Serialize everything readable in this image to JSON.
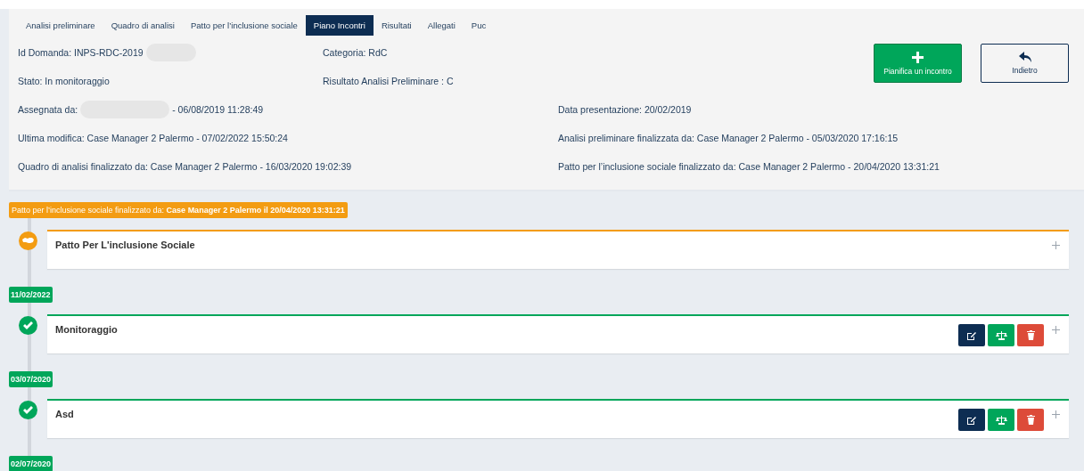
{
  "tabs": [
    {
      "label": "Analisi preliminare",
      "selected": false
    },
    {
      "label": "Quadro di analisi",
      "selected": false
    },
    {
      "label": "Patto per l’inclusione sociale",
      "selected": false
    },
    {
      "label": "Piano Incontri",
      "selected": true
    },
    {
      "label": "Risultati",
      "selected": false
    },
    {
      "label": "Allegati",
      "selected": false
    },
    {
      "label": "Puc",
      "selected": false
    }
  ],
  "info_top": [
    [
      {
        "text": "Id Domanda: INPS-RDC-2019",
        "redacted": true
      },
      {
        "text": "Categoria: RdC"
      }
    ],
    [
      {
        "text": "Stato: In monitoraggio"
      },
      {
        "text": "Risultato Analisi Preliminare : C"
      }
    ]
  ],
  "info_rows": [
    [
      {
        "text": "Assegnata da:",
        "redacted": true,
        "suffix": "- 06/08/2019 11:28:49"
      },
      {
        "text": "Data presentazione: 20/02/2019"
      }
    ],
    [
      {
        "text": "Ultima modifica: Case Manager 2 Palermo - 07/02/2022 15:50:24"
      },
      {
        "text": "Analisi preliminare finalizzata da: Case Manager 2 Palermo - 05/03/2020 17:16:15"
      }
    ],
    [
      {
        "text": "Quadro di analisi finalizzato da: Case Manager 2 Palermo - 16/03/2020 19:02:39"
      },
      {
        "text": "Patto per l’inclusione sociale finalizzato da: Case Manager 2 Palermo - 20/04/2020 13:31:21"
      }
    ]
  ],
  "buttons": [
    {
      "kind": "add",
      "label": "Pianifica un incontro"
    },
    {
      "kind": "back",
      "label": "Indietro"
    }
  ],
  "timeline": [
    {
      "kind": "banner",
      "text": "Patto per l’inclusione sociale finalizzato da: **Case Manager 2 Palermo il 20/04/2020 13:31:21**"
    },
    {
      "kind": "pact",
      "title": "Patto Per L'inclusione Sociale",
      "actions": false
    },
    {
      "kind": "date",
      "text": "11/02/2022"
    },
    {
      "kind": "meeting",
      "title": "Monitoraggio",
      "actions": true
    },
    {
      "kind": "date",
      "text": "03/07/2020"
    },
    {
      "kind": "meeting",
      "title": "Asd",
      "actions": true
    },
    {
      "kind": "date",
      "text": "02/07/2020"
    }
  ]
}
